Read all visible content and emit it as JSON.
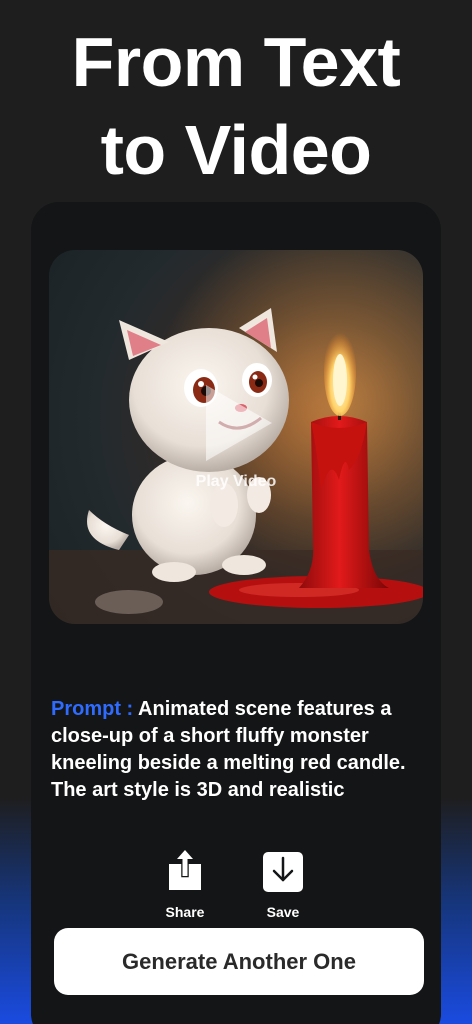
{
  "hero": {
    "title_line1": "From Text",
    "title_line2": "to Video"
  },
  "video": {
    "play_label": "Play Video"
  },
  "prompt": {
    "label": "Prompt :",
    "text": "Animated scene features a close-up of a short fluffy monster kneeling beside a melting red candle. The art style is 3D and realistic"
  },
  "actions": {
    "share_label": "Share",
    "save_label": "Save"
  },
  "generate_button": {
    "label": "Generate Another One"
  },
  "colors": {
    "background": "#1e1e1f",
    "card": "#141516",
    "accent_blue": "#2f6bff",
    "gradient_bottom": "#1a4be0",
    "button_bg": "#ffffff"
  },
  "icons": [
    "play-icon",
    "share-icon",
    "save-icon"
  ]
}
